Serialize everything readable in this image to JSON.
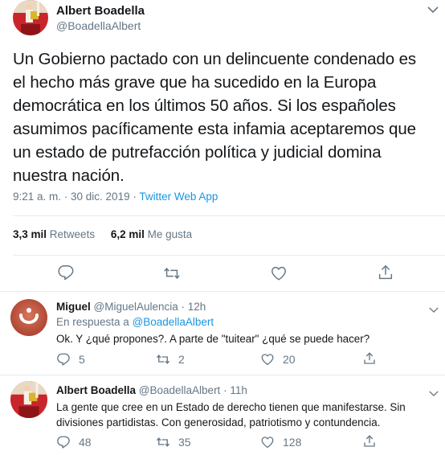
{
  "main_tweet": {
    "author_name": "Albert Boadella",
    "author_handle": "@BoadellaAlbert",
    "text_lines": [
      "Un Gobierno pactado con un delincuente condenado es",
      "el hecho más grave que ha sucedido en la Europa",
      "democrática en los últimos 50 años. Si los españoles",
      "asumimos pacíficamente esta infamia aceptaremos que",
      "un estado de putrefacción política y judicial domina",
      "nuestra nación."
    ],
    "timestamp": "9:21 a. m. · 30 dic. 2019 ·",
    "source": "Twitter Web App",
    "retweets_count": "3,3 mil",
    "retweets_label": "Retweets",
    "likes_count": "6,2 mil",
    "likes_label": "Me gusta"
  },
  "replies": [
    {
      "author_name": "Miguel",
      "author_handle": "@MiguelAulencia",
      "time": "· 12h",
      "reply_to_prefix": "En respuesta a",
      "reply_to_handle": "@BoadellaAlbert",
      "text_lines": [
        "Ok. Y ¿qué propones?. A parte de \"tuitear\" ¿qué se puede hacer?"
      ],
      "replies": "5",
      "retweets": "2",
      "likes": "20"
    },
    {
      "author_name": "Albert Boadella",
      "author_handle": "@BoadellaAlbert",
      "time": "· 11h",
      "text_lines": [
        "La gente que cree en un Estado de derecho tienen que manifestarse. Sin",
        "divisiones partidistas. Con generosidad, patriotismo y contundencia."
      ],
      "replies": "48",
      "retweets": "35",
      "likes": "128"
    }
  ],
  "icons": {
    "reply": "reply-icon",
    "retweet": "retweet-icon",
    "like": "heart-icon",
    "share": "share-icon",
    "more": "chevron-down-icon"
  },
  "colors": {
    "link": "#1b95e0",
    "muted": "#657786",
    "text": "#14171a",
    "divider": "#e6ecf0"
  }
}
